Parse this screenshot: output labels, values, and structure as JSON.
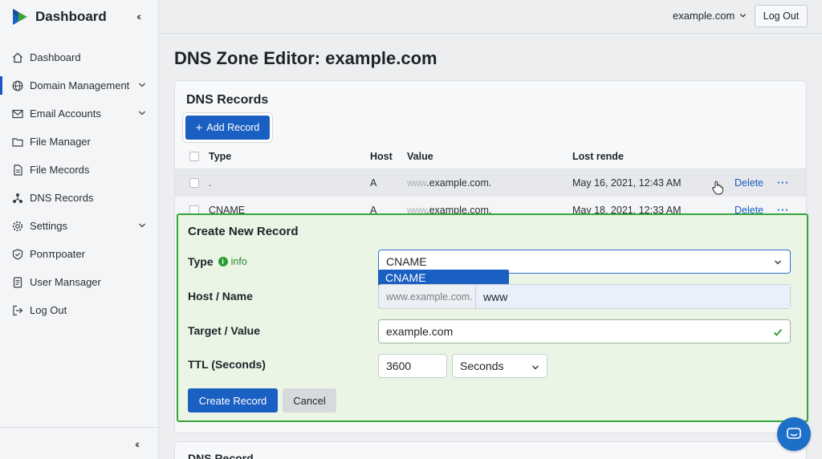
{
  "app": {
    "title": "Dashboard",
    "accent": "#1a5fc2"
  },
  "sidebar": {
    "items": [
      {
        "label": "Dashboard",
        "icon": "home-icon",
        "expandable": false
      },
      {
        "label": "Domain Management",
        "icon": "globe-icon",
        "expandable": true,
        "active": true
      },
      {
        "label": "Email Accounts",
        "icon": "mail-icon",
        "expandable": true
      },
      {
        "label": "File Manager",
        "icon": "folder-icon",
        "expandable": false
      },
      {
        "label": "File Mecords",
        "icon": "file-icon",
        "expandable": false
      },
      {
        "label": "DNS Records",
        "icon": "network-icon",
        "expandable": false
      },
      {
        "label": "Settings",
        "icon": "gear-icon",
        "expandable": true
      },
      {
        "label": "Ponπpoater",
        "icon": "shield-icon",
        "expandable": false
      },
      {
        "label": "User Mansager",
        "icon": "document-icon",
        "expandable": false
      },
      {
        "label": "Log Out",
        "icon": "logout-icon",
        "expandable": false
      }
    ]
  },
  "header": {
    "domain": "example.com",
    "logout_label": "Log Out"
  },
  "page": {
    "title": "DNS Zone Editor: example.com"
  },
  "records": {
    "title": "DNS Records",
    "add_label": "Add Record",
    "columns": {
      "type": "Type",
      "host": "Host",
      "value": "Value",
      "last": "Lost rende"
    },
    "rows": [
      {
        "type": ".",
        "host": "A",
        "value_blur": "www",
        "value": ".example.com.",
        "date": "May 16, 2021, 12:43 AM",
        "delete": "Delete",
        "more": "···"
      },
      {
        "type": "CNAME",
        "host": "A",
        "value_blur": "www",
        "value": ".example.com.",
        "date": "May 18, 2021, 12:33 AM",
        "delete": "Delete",
        "more": "···"
      }
    ]
  },
  "create": {
    "title": "Create New Record",
    "type_label": "Type",
    "info_label": "info",
    "type_value": "CNAME",
    "type_option_highlighted": "CNAME",
    "host_label": "Host / Name",
    "host_prefix": "www.example.com.",
    "host_value": "www",
    "target_label": "Target / Value",
    "target_value": "example.com",
    "ttl_label": "TTL (Seconds)",
    "ttl_value": "3600",
    "ttl_unit": "Seconds",
    "submit_label": "Create Record",
    "cancel_label": "Cancel",
    "panel_color": "#37a43b"
  },
  "second_card": {
    "title": "DNS Record"
  }
}
